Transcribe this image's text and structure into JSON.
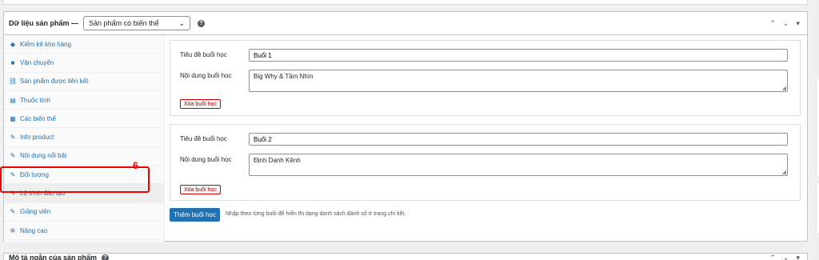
{
  "metabox": {
    "title": "Dữ liệu sản phẩm —",
    "product_type": "Sản phẩm có biến thể",
    "help": "?",
    "header_actions": [
      "⌃",
      "⌄",
      "▾"
    ]
  },
  "sidebar": {
    "items": [
      {
        "label": "Kiểm kê kho hàng",
        "icon": "◆"
      },
      {
        "label": "Vận chuyển",
        "icon": "■"
      },
      {
        "label": "Sản phẩm được liên kết",
        "icon": "⛓"
      },
      {
        "label": "Thuộc tính",
        "icon": "▤"
      },
      {
        "label": "Các biến thể",
        "icon": "▦"
      },
      {
        "label": "Info product",
        "icon": "✎"
      },
      {
        "label": "Nội dung nổi bật",
        "icon": "✎"
      },
      {
        "label": "Đối tượng",
        "icon": "✎"
      },
      {
        "label": "Lộ trình đào tạo",
        "icon": "✎"
      },
      {
        "label": "Giảng viên",
        "icon": "✎"
      },
      {
        "label": "Nâng cao",
        "icon": "✲"
      }
    ]
  },
  "annotation": {
    "step": "6"
  },
  "lessons": [
    {
      "title_label": "Tiêu đề buổi học",
      "title_value": "Buổi 1",
      "content_label": "Nội dung buổi học",
      "content_value": "Big Why & Tầm Nhìn",
      "delete_label": "Xóa buổi học"
    },
    {
      "title_label": "Tiêu đề buổi học",
      "title_value": "Buổi 2",
      "content_label": "Nội dung buổi học",
      "content_value": "Định Danh Kênh",
      "delete_label": "Xóa buổi học"
    }
  ],
  "add_button": "Thêm buổi học",
  "hint": "Nhập theo từng buổi để hiển thị dạng danh sách đánh số ở trang chi tiết.",
  "bottom_box": {
    "title": "Mô tả ngắn của sản phẩm",
    "help": "?"
  }
}
